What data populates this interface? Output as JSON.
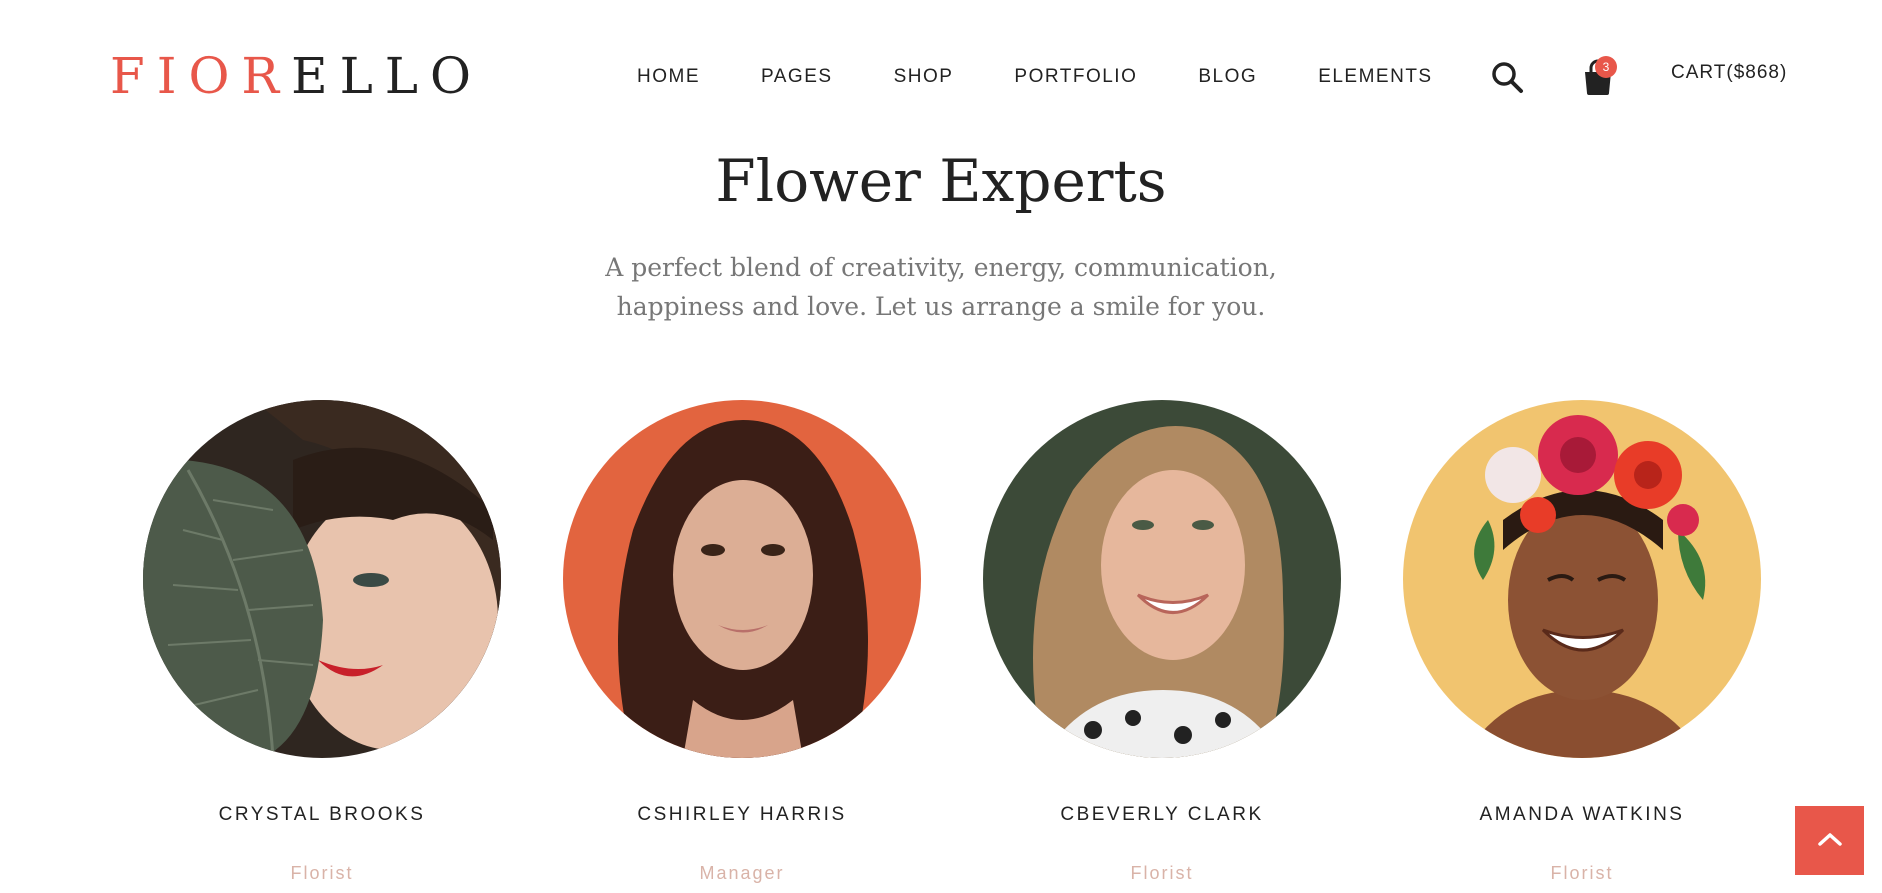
{
  "brand": {
    "accent_part": "FIOR",
    "rest_part": "ELLO",
    "accent_color": "#e8574a"
  },
  "nav": {
    "items": [
      {
        "label": "HOME"
      },
      {
        "label": "PAGES"
      },
      {
        "label": "SHOP"
      },
      {
        "label": "PORTFOLIO"
      },
      {
        "label": "BLOG"
      },
      {
        "label": "ELEMENTS"
      }
    ],
    "search_icon": "search-icon",
    "cart_icon": "shopping-bag-icon",
    "cart_count": "3",
    "cart_label": "CART($868)"
  },
  "section": {
    "title": "Flower Experts",
    "subtitle": "A perfect blend of creativity, energy, communication, happiness and love. Let us arrange a smile for you."
  },
  "team": [
    {
      "name": "CRYSTAL BROOKS",
      "role": "Florist"
    },
    {
      "name": "CSHIRLEY HARRIS",
      "role": "Manager"
    },
    {
      "name": "CBEVERLY CLARK",
      "role": "Florist"
    },
    {
      "name": "AMANDA WATKINS",
      "role": "Florist"
    }
  ],
  "back_to_top": {
    "icon": "chevron-up-icon"
  },
  "colors": {
    "accent": "#e8574a",
    "role_text": "#d9b3a8",
    "subtitle_text": "#777777"
  }
}
